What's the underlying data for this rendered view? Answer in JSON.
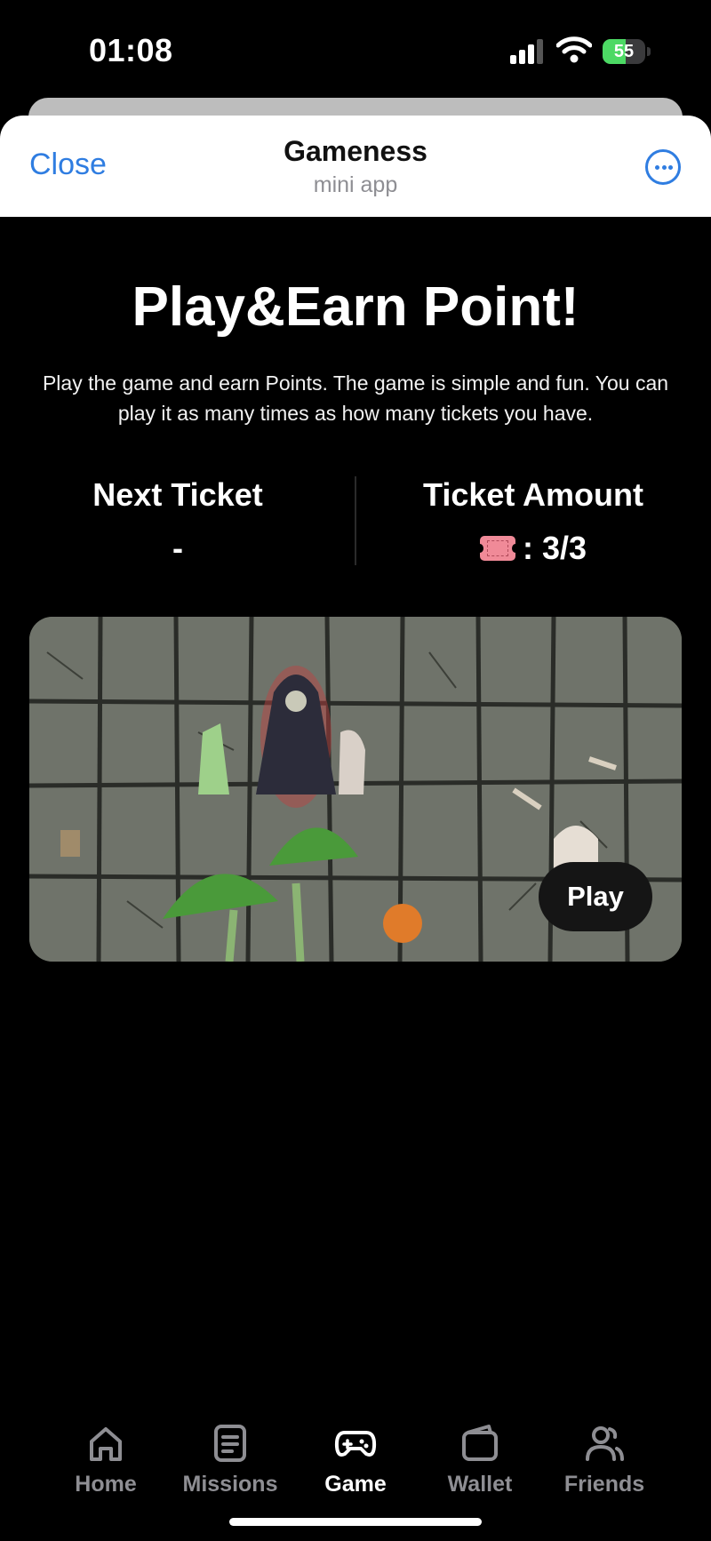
{
  "status_bar": {
    "time": "01:08",
    "battery": "55",
    "battery_fraction": 0.55
  },
  "header": {
    "close_label": "Close",
    "title": "Gameness",
    "subtitle": "mini app"
  },
  "main": {
    "title": "Play&Earn Point!",
    "description": "Play the game and earn Points. The game is simple and fun. You can play it as many times as how many tickets you have.",
    "stats": {
      "next_ticket_label": "Next Ticket",
      "next_ticket_value": "-",
      "ticket_amount_label": "Ticket Amount",
      "ticket_amount_value": ": 3/3"
    },
    "play_label": "Play"
  },
  "tab_bar": {
    "tabs": [
      {
        "label": "Home",
        "icon": "home-icon"
      },
      {
        "label": "Missions",
        "icon": "missions-icon"
      },
      {
        "label": "Game",
        "icon": "gamepad-icon"
      },
      {
        "label": "Wallet",
        "icon": "wallet-icon"
      },
      {
        "label": "Friends",
        "icon": "friends-icon"
      }
    ],
    "active": "Game"
  },
  "colors": {
    "accent": "#2f7de1",
    "background": "#000000",
    "inactive_tab": "#8e8e93",
    "battery_green": "#4cd964"
  }
}
